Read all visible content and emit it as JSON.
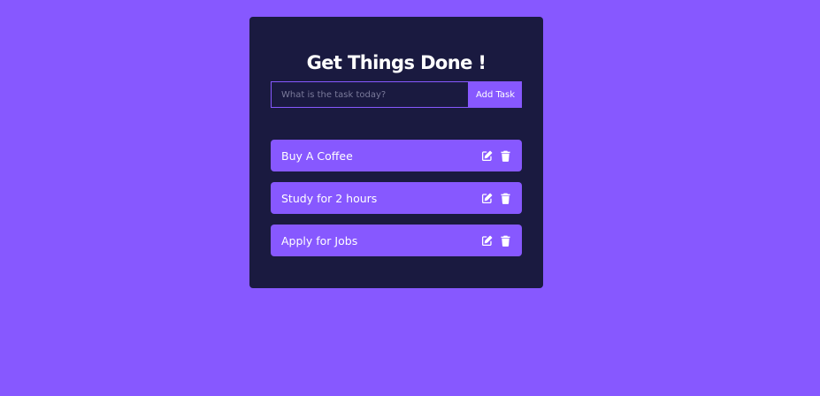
{
  "app": {
    "title": "Get Things Done !"
  },
  "form": {
    "placeholder": "What is the task today?",
    "value": "",
    "submit_label": "Add Task"
  },
  "todos": [
    {
      "text": "Buy A Coffee",
      "edit_icon": "edit-icon",
      "delete_icon": "trash-icon"
    },
    {
      "text": "Study for 2 hours",
      "edit_icon": "edit-icon",
      "delete_icon": "trash-icon"
    },
    {
      "text": "Apply for Jobs",
      "edit_icon": "edit-icon",
      "delete_icon": "trash-icon"
    }
  ],
  "colors": {
    "background": "#8758ff",
    "panel": "#1a1a40",
    "item": "#8758ff",
    "text": "#ffffff"
  }
}
